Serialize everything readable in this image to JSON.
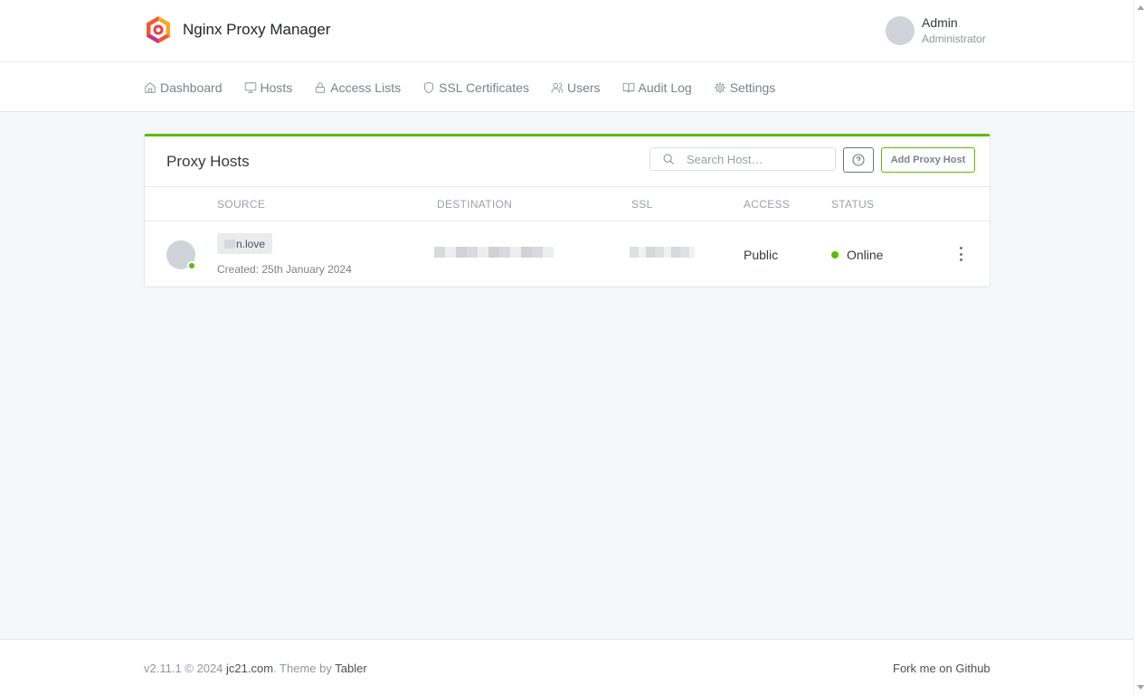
{
  "app": {
    "title": "Nginx Proxy Manager"
  },
  "user": {
    "name": "Admin",
    "role": "Administrator"
  },
  "nav": {
    "items": [
      {
        "label": "Dashboard",
        "icon": "home-icon"
      },
      {
        "label": "Hosts",
        "icon": "monitor-icon"
      },
      {
        "label": "Access Lists",
        "icon": "lock-icon"
      },
      {
        "label": "SSL Certificates",
        "icon": "shield-icon"
      },
      {
        "label": "Users",
        "icon": "users-icon"
      },
      {
        "label": "Audit Log",
        "icon": "book-icon"
      },
      {
        "label": "Settings",
        "icon": "gear-icon"
      }
    ]
  },
  "card": {
    "title": "Proxy Hosts",
    "search_placeholder": "Search Host…",
    "add_label": "Add Proxy Host",
    "columns": [
      "Source",
      "Destination",
      "SSL",
      "Access",
      "Status"
    ],
    "rows": [
      {
        "source": "n.love",
        "created": "Created: 25th January 2024",
        "access": "Public",
        "status": "Online"
      }
    ]
  },
  "footer": {
    "version": "v2.11.1 © 2024",
    "company": "jc21.com",
    "theme_by": ". Theme by",
    "theme": "Tabler",
    "fork": "Fork me on Github"
  },
  "colors": {
    "accent": "#5eba00",
    "background": "#f5f7fb"
  }
}
